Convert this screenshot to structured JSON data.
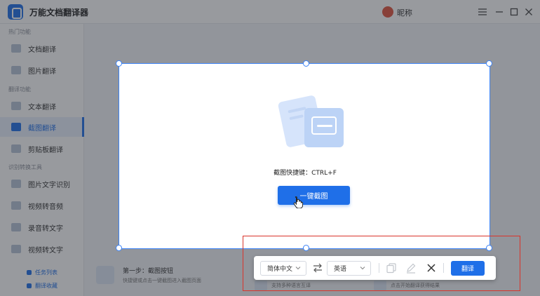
{
  "app": {
    "title": "万能文档翻译器",
    "nickname": "昵称"
  },
  "window_controls": [
    "menu-icon",
    "minimize-icon",
    "maximize-icon",
    "close-icon"
  ],
  "sidebar": {
    "sections": [
      {
        "label": "热门功能",
        "items": [
          {
            "label": "文档翻译",
            "icon": "document-icon"
          },
          {
            "label": "图片翻译",
            "icon": "image-icon"
          }
        ]
      },
      {
        "label": "翻译功能",
        "items": [
          {
            "label": "文本翻译",
            "icon": "text-icon"
          },
          {
            "label": "截图翻译",
            "icon": "screenshot-icon",
            "active": true
          },
          {
            "label": "剪贴板翻译",
            "icon": "clipboard-icon"
          }
        ]
      },
      {
        "label": "识别转换工具",
        "items": [
          {
            "label": "图片文字识别",
            "icon": "ocr-icon"
          },
          {
            "label": "视频转音频",
            "icon": "video-icon"
          },
          {
            "label": "录音转文字",
            "icon": "audio-icon"
          },
          {
            "label": "视频转文字",
            "icon": "video-text-icon"
          }
        ]
      }
    ],
    "links": [
      {
        "label": "任务列表"
      },
      {
        "label": "翻译收藏"
      }
    ]
  },
  "main": {
    "step1": {
      "title": "第一步：截图按钮",
      "desc": "快捷键或点击一键截图进入截图页面"
    },
    "step2": {
      "desc": "支持多种语言互译"
    },
    "step3": {
      "desc": "点击开始翻译获得结果"
    }
  },
  "capture": {
    "hint": "截图快捷键：CTRL+F",
    "button_label": "一键截图"
  },
  "toolbar": {
    "source_lang": "简体中文",
    "target_lang": "英语",
    "translate_label": "翻译",
    "icons": [
      "copy-icon",
      "edit-icon",
      "close-icon"
    ]
  },
  "colors": {
    "accent": "#1f6fe8",
    "selection": "#3b82f6",
    "highlight": "#d9342b"
  }
}
